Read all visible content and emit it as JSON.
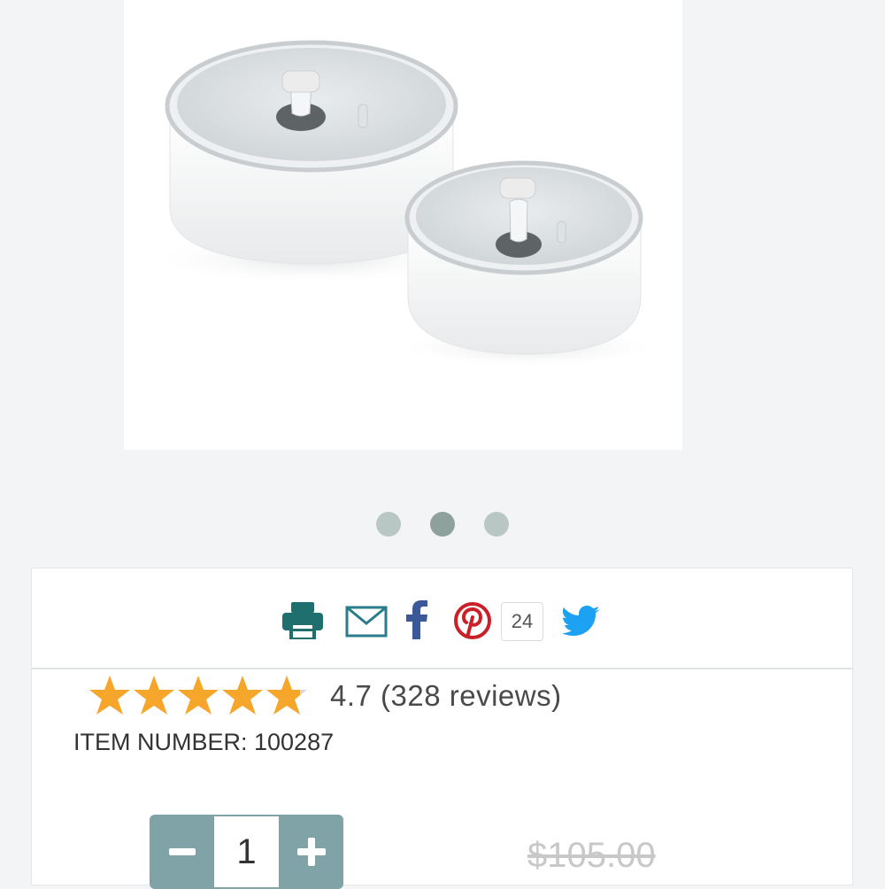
{
  "product": {
    "image_alt": "White round containers with glass lids",
    "item_number": "ITEM NUMBER: 100287",
    "original_price": "$105.00"
  },
  "carousel": {
    "dots": 3,
    "active_index": 1
  },
  "share": {
    "pinterest_count": "24",
    "icons": [
      "print-icon",
      "email-icon",
      "facebook-icon",
      "pinterest-icon",
      "twitter-icon"
    ]
  },
  "rating": {
    "value": 4.7,
    "text": "4.7 (328 reviews)"
  },
  "quantity": {
    "value": "1",
    "minus_label": "−",
    "plus_label": "+"
  },
  "colors": {
    "star": "#f6a62b",
    "stepper": "#7fa3a6",
    "print": "#1f6f6f",
    "email": "#2a7d8a",
    "facebook": "#3b5998",
    "pinterest": "#cb2027",
    "twitter": "#1da1f2"
  }
}
